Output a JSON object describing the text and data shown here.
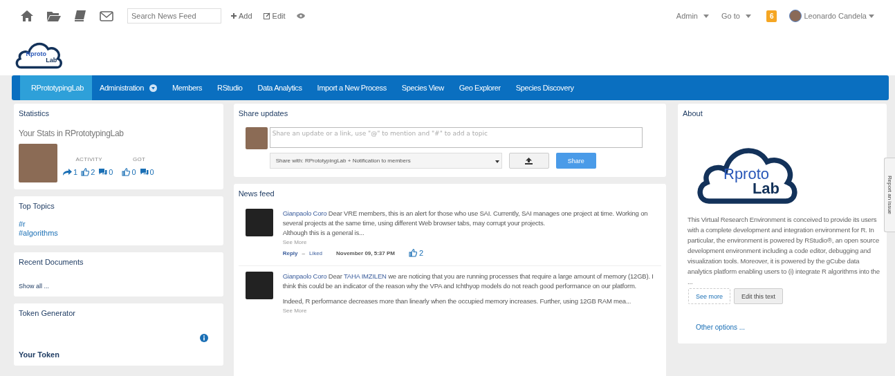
{
  "toolbar": {
    "search": {
      "placeholder": "Search News Feed"
    },
    "actions": [
      {
        "kind": "add",
        "label": "Add"
      },
      {
        "kind": "edit",
        "label": "Edit"
      },
      {
        "kind": "eye"
      }
    ],
    "menus": [
      {
        "label": "Admin"
      },
      {
        "label": "Go to"
      }
    ],
    "notifications": "6",
    "user": "Leonardo Candela"
  },
  "logo": {
    "line1": "Rproto",
    "line2": "Lab"
  },
  "about_logo": {
    "line1": "Rproto",
    "line2": "Lab"
  },
  "nav": [
    {
      "label": "RPrototypingLab",
      "selected": true,
      "dropdown": false
    },
    {
      "label": "Administration",
      "selected": false,
      "dropdown": true
    },
    {
      "label": "Members",
      "selected": false,
      "dropdown": false
    },
    {
      "label": "RStudio",
      "selected": false,
      "dropdown": false
    },
    {
      "label": "Data Analytics",
      "selected": false,
      "dropdown": false
    },
    {
      "label": "Import a New Process",
      "selected": false,
      "dropdown": false
    },
    {
      "label": "Species View",
      "selected": false,
      "dropdown": false
    },
    {
      "label": "Geo Explorer",
      "selected": false,
      "dropdown": false
    },
    {
      "label": "Species Discovery",
      "selected": false,
      "dropdown": false
    }
  ],
  "statistics": {
    "title": "Statistics",
    "subtitle": "Your Stats in RPrototypingLab",
    "activity_label": "ACTIVITY",
    "got_label": "GOT",
    "activity": [
      {
        "kind": "share",
        "count": "1"
      },
      {
        "kind": "like",
        "count": "2"
      },
      {
        "kind": "comment",
        "count": "0"
      }
    ],
    "got": [
      {
        "kind": "like",
        "count": "0"
      },
      {
        "kind": "comment",
        "count": "0"
      }
    ]
  },
  "top_topics": {
    "title": "Top Topics",
    "topics": [
      "#r",
      "#algorithms"
    ]
  },
  "recent_documents": {
    "title": "Recent Documents",
    "link": "Show all ..."
  },
  "token_generator": {
    "title": "Token Generator",
    "subtitle": "Your Token"
  },
  "share_updates": {
    "title": "Share updates",
    "placeholder": "Share an update or a link, use \"@\" to mention and \"#\" to add a topic",
    "share_with": "Share with: RPrototypingLab + Notification to members",
    "button": "Share"
  },
  "news_feed": {
    "title": "News feed",
    "posts": [
      {
        "paragraphs": [
          [
            {
              "kind": "author",
              "text": "Gianpaolo Coro"
            },
            {
              "kind": "text",
              "text": " Dear VRE members, this is an alert for those who use SAI. Currently, SAI manages one project at time. Working on several projects at the same time, using different Web browser tabs, may corrupt your projects.\nAlthough this is a general is..."
            }
          ]
        ],
        "see_more": "See More",
        "footer": {
          "reply": "Reply",
          "separator": "–",
          "liked": "Liked",
          "date": "November 09, 5:37 PM",
          "likes": "2"
        }
      },
      {
        "paragraphs": [
          [
            {
              "kind": "author",
              "text": "Gianpaolo Coro"
            },
            {
              "kind": "text",
              "text": " Dear "
            },
            {
              "kind": "mention",
              "text": "TAHA IMZILEN"
            },
            {
              "kind": "text",
              "text": " we are noticing that you are running processes that require a large amount of memory (12GB). I think this could be an indicator of the reason why the VPA and Ichthyop models do not reach good performance on our platform."
            }
          ],
          [
            {
              "kind": "text",
              "text": "Indeed, R performance decreases more than linearly when the occupied memory increases. Further, using 12GB RAM mea..."
            }
          ]
        ],
        "see_more": "See More"
      }
    ]
  },
  "about": {
    "title": "About",
    "text": "This Virtual Research Environment is conceived to provide its users with a complete development and integration environment for R. In particular, the environment is powered by RStudio®, an open source development environment including a code editor, debugging and visualization tools. Moreover, it is powered by the gCube data analytics platform enabling users to (i) integrate R algorithms into the ...",
    "see_more": "See more",
    "edit": "Edit this text",
    "other_options": "Other options ..."
  },
  "report_issue": "Report an issue"
}
